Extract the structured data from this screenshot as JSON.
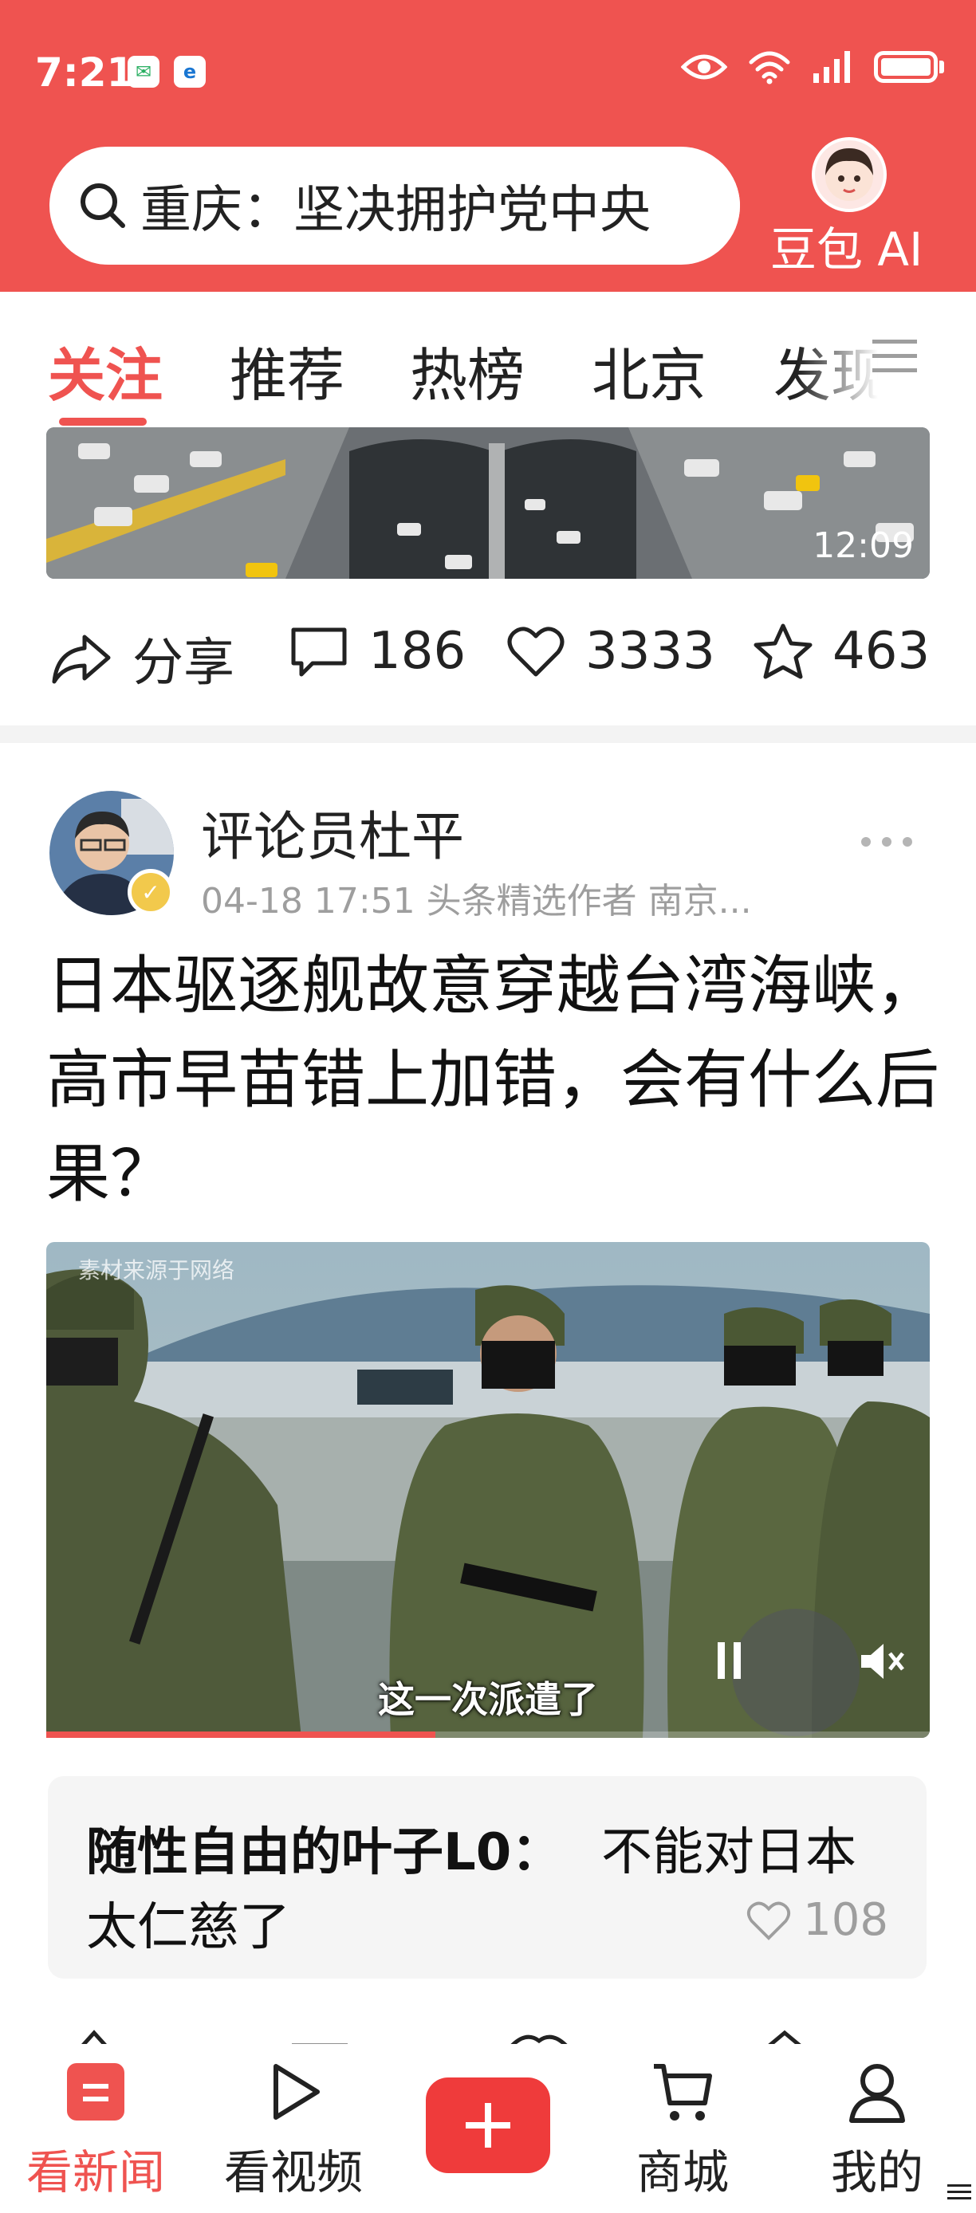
{
  "status_bar": {
    "time": "7:21",
    "icons": [
      "wechat-icon",
      "browser-icon",
      "eye-icon",
      "wifi-icon",
      "signal-icon",
      "battery-icon"
    ]
  },
  "header": {
    "search_text": "重庆：坚决拥护党中央",
    "ai_label": "豆包 AI",
    "accent_color": "#ef5350"
  },
  "tabs": {
    "items": [
      "关注",
      "推荐",
      "热榜",
      "北京",
      "发现"
    ],
    "active": "关注"
  },
  "feed_item_1": {
    "duration": "12:09",
    "actions": {
      "share_label": "分享",
      "comments": "186",
      "likes": "3333",
      "favorites": "463"
    }
  },
  "feed_item_2": {
    "author": "评论员杜平",
    "meta": "04-18 17:51  头条精选作者 南京...",
    "title": "日本驱逐舰故意穿越台湾海峡，高市早苗错上加错，会有什么后果？",
    "video": {
      "watermark": "素材来源于网络",
      "subtitle": "这一次派遣了",
      "progress": 0.44
    },
    "top_comment": {
      "user": "随性自由的叶子L0：",
      "text_line1": "不能对日本",
      "text_line2": "太仁慈了",
      "likes": "108"
    }
  },
  "bottom_nav": {
    "items": [
      {
        "label": "看新闻",
        "active": true
      },
      {
        "label": "看视频",
        "active": false
      },
      {
        "label": "商城",
        "active": false
      },
      {
        "label": "我的",
        "active": false
      }
    ]
  }
}
